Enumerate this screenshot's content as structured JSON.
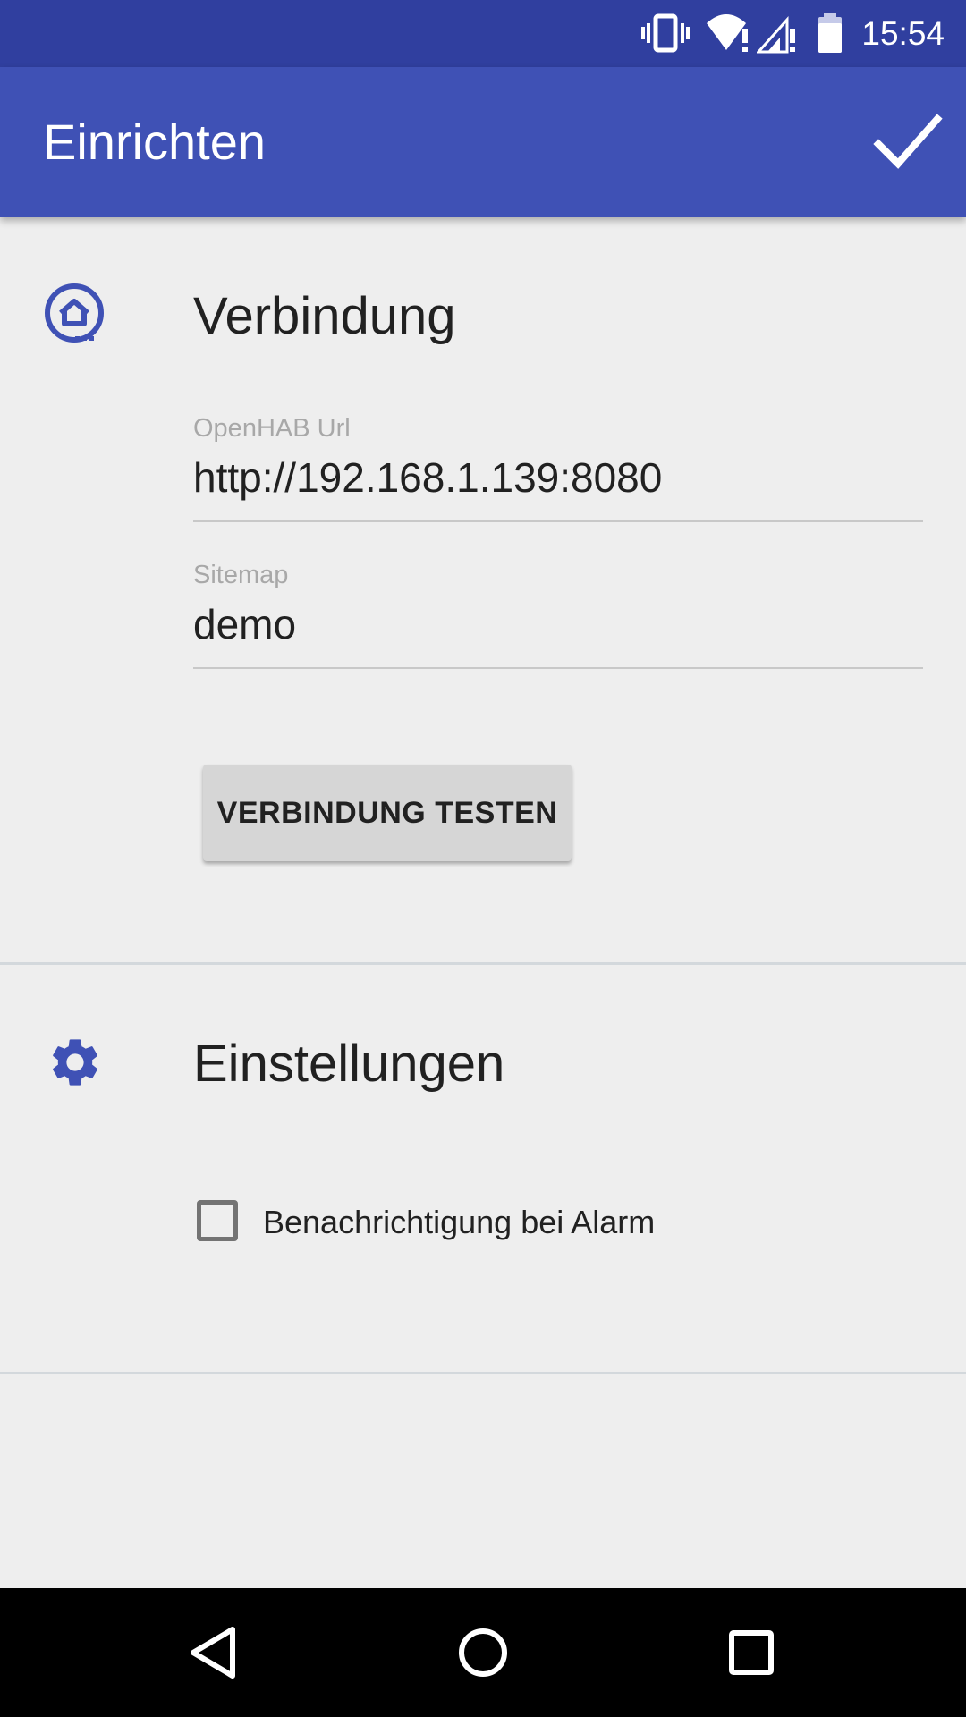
{
  "status_bar": {
    "time": "15:54",
    "icons": [
      "vibrate-icon",
      "wifi-alert-icon",
      "cellular-alert-icon",
      "battery-icon"
    ]
  },
  "app_bar": {
    "title": "Einrichten",
    "confirm_icon": "check-icon"
  },
  "connection": {
    "icon": "openhab-logo-icon",
    "title": "Verbindung",
    "url_field": {
      "label": "OpenHAB Url",
      "value": "http://192.168.1.139:8080"
    },
    "sitemap_field": {
      "label": "Sitemap",
      "value": "demo"
    },
    "test_button_label": "VERBINDUNG TESTEN"
  },
  "settings": {
    "icon": "gear-icon",
    "title": "Einstellungen",
    "alarm_checkbox": {
      "label": "Benachrichtigung bei Alarm",
      "checked": false
    }
  },
  "nav_bar": {
    "icons": [
      "back-icon",
      "home-icon",
      "recents-icon"
    ]
  },
  "colors": {
    "primary": "#3f51b5",
    "primary_dark": "#303f9f",
    "background": "#eeeeee"
  }
}
